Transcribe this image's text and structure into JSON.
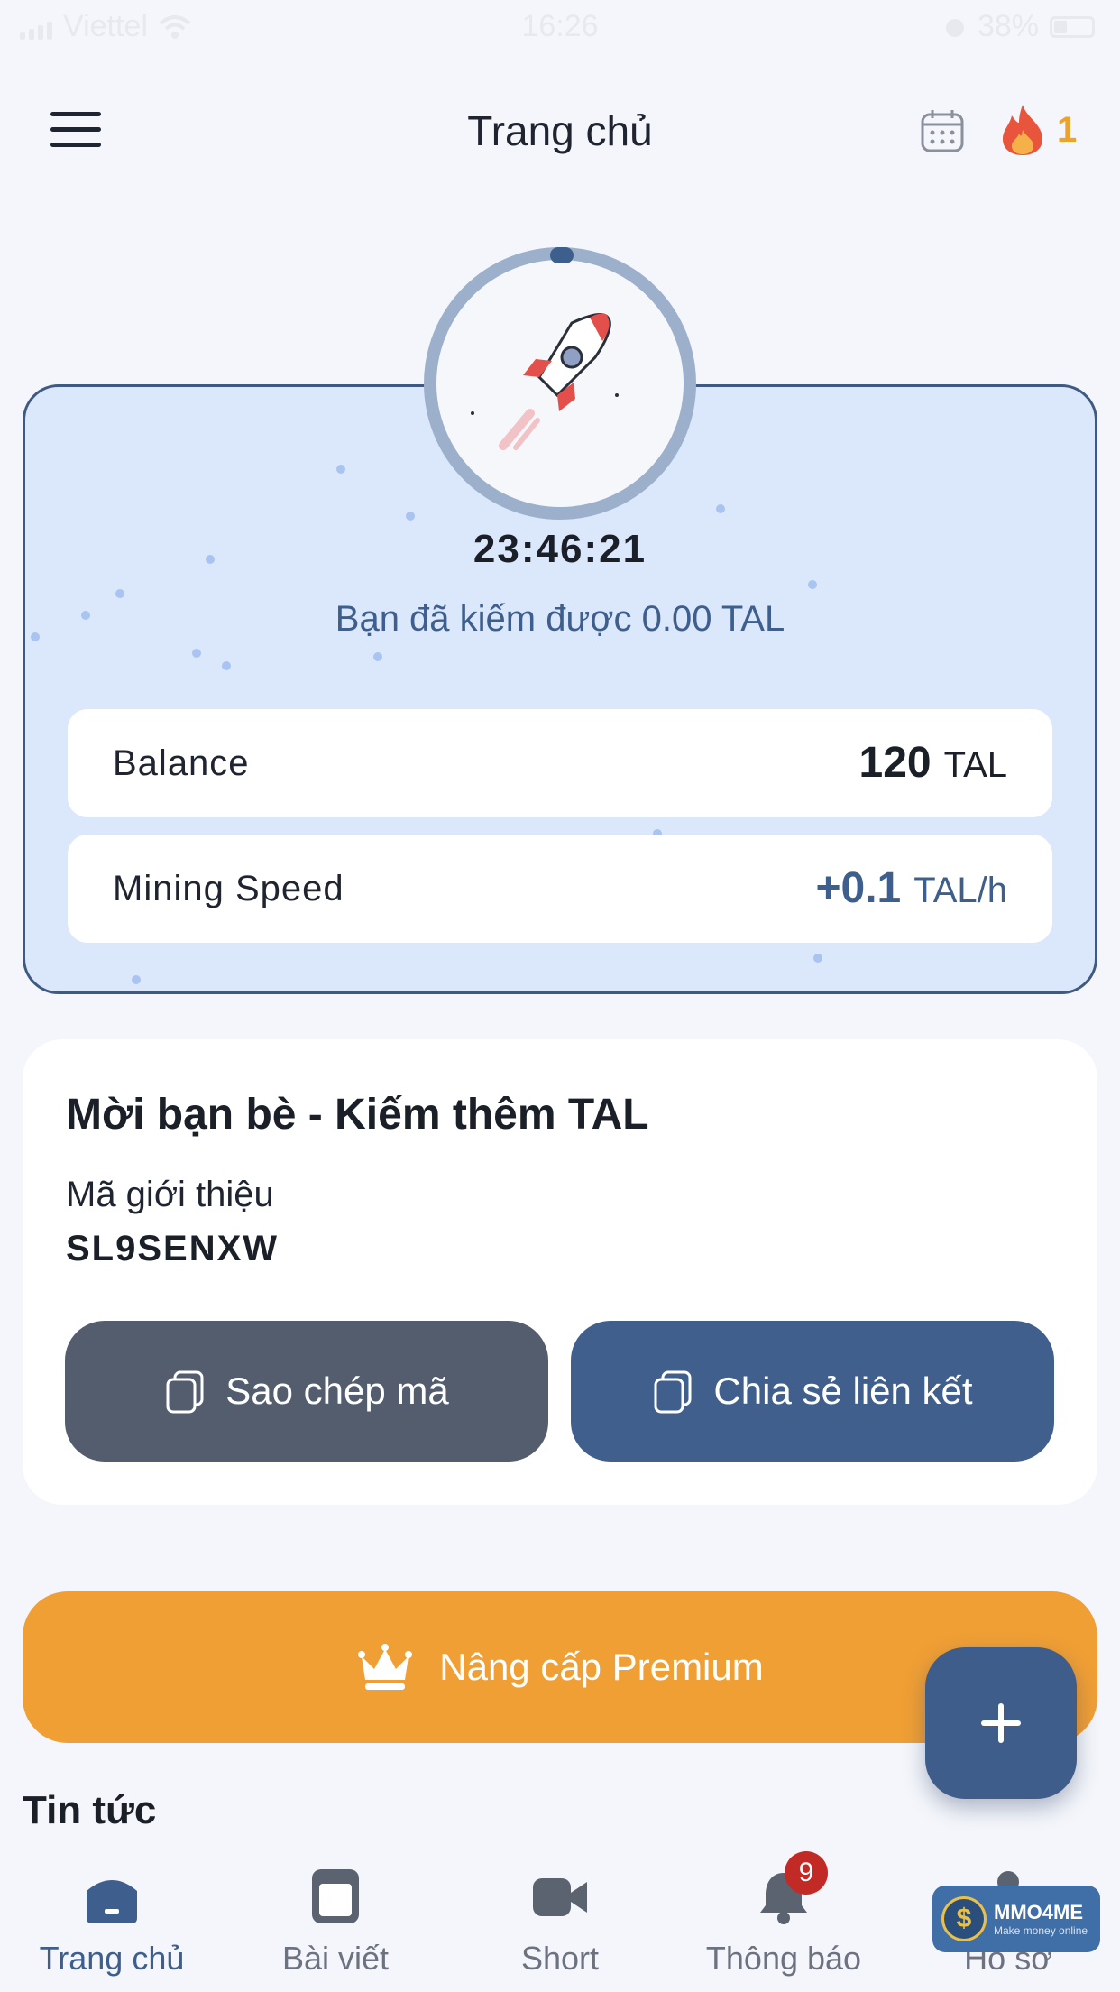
{
  "status_bar": {
    "carrier": "Viettel",
    "time": "16:26",
    "battery": "38%"
  },
  "header": {
    "title": "Trang chủ",
    "streak_count": "1"
  },
  "mining": {
    "timer": "23:46:21",
    "earned_text": "Bạn đã kiếm được 0.00 TAL",
    "balance_label": "Balance",
    "balance_value": "120",
    "balance_unit": "TAL",
    "speed_label": "Mining Speed",
    "speed_value": "+0.1",
    "speed_unit": "TAL/h",
    "progress_fraction": 0.01
  },
  "invite": {
    "title": "Mời bạn bè - Kiếm thêm TAL",
    "referral_label": "Mã giới thiệu",
    "referral_code": "SL9SENXW",
    "copy_button": "Sao chép mã",
    "share_button": "Chia sẻ liên kết"
  },
  "premium": {
    "label": "Nâng cấp Premium"
  },
  "news": {
    "title": "Tin tức"
  },
  "bottom_nav": {
    "items": [
      {
        "label": "Trang chủ",
        "icon": "home-icon",
        "active": true
      },
      {
        "label": "Bài viết",
        "icon": "article-icon",
        "active": false
      },
      {
        "label": "Short",
        "icon": "video-icon",
        "active": false
      },
      {
        "label": "Thông báo",
        "icon": "bell-icon",
        "active": false
      },
      {
        "label": "Hồ sơ",
        "icon": "profile-icon",
        "active": false
      }
    ],
    "notification_badge": "9"
  },
  "watermark": {
    "title": "MMO4ME",
    "subtitle": "Make money online"
  },
  "colors": {
    "primary": "#405f8c",
    "premium": "#f09f35",
    "card_bg": "#dbe7fb",
    "streak": "#f0a12b"
  }
}
